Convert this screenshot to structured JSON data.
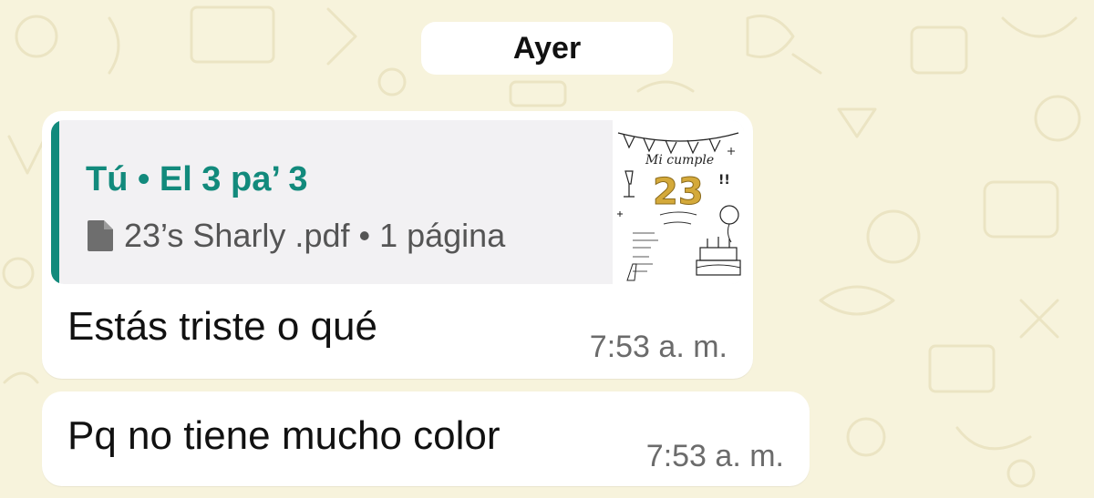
{
  "chat": {
    "date_divider": "Ayer"
  },
  "messages": [
    {
      "quote": {
        "author": "Tú • El 3 pa’ 3",
        "file": "23’s Sharly .pdf • 1 página",
        "file_icon": "document-icon",
        "thumbnail": {
          "title": "Mi cumple",
          "number": "23",
          "exclaim": "!!"
        }
      },
      "text": "Estás triste o qué",
      "time": "7:53 a. m."
    },
    {
      "text": "Pq no tiene mucho color",
      "time": "7:53 a. m."
    }
  ],
  "colors": {
    "wallpaper": "#f7f3dc",
    "bubble": "#ffffff",
    "quote_accent": "#128a7c",
    "quote_background": "#f2f1f3"
  }
}
